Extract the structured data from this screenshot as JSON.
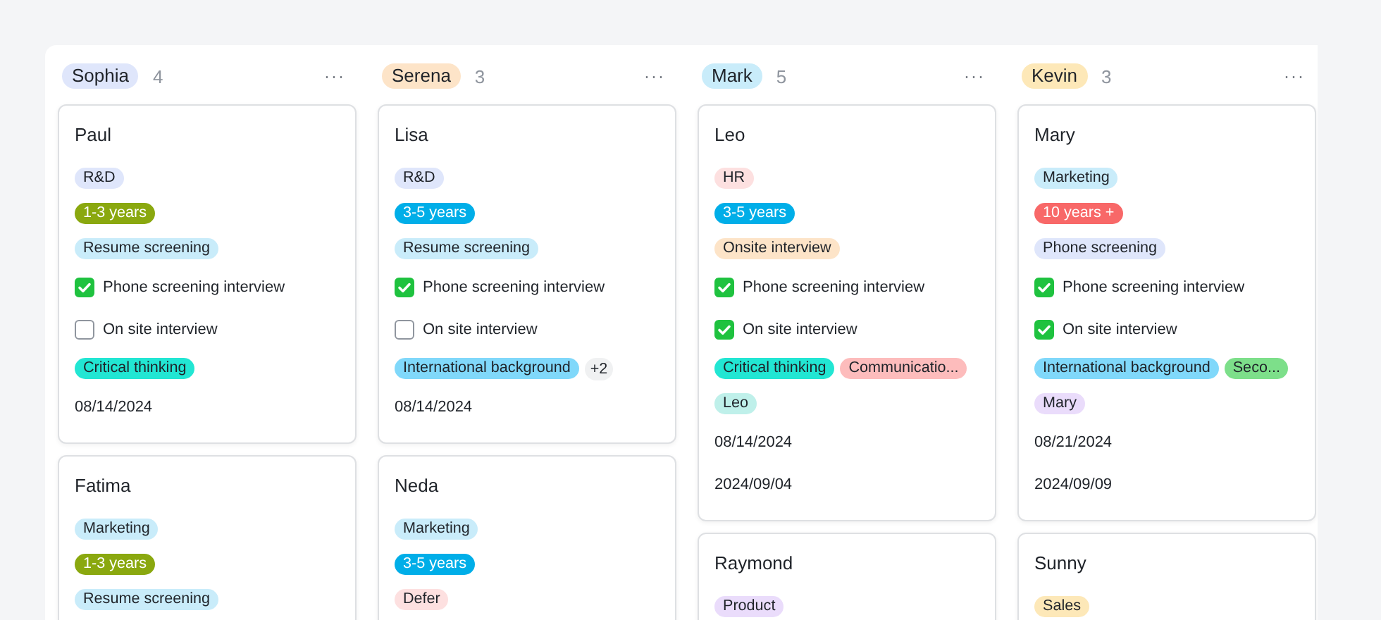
{
  "columns": [
    {
      "owner": {
        "name": "Sophia",
        "color": "#dfe6fb"
      },
      "count": "4",
      "menu": "···",
      "cards": [
        {
          "name": "Paul",
          "rows": [
            {
              "kind": "tag",
              "text": "R&D",
              "color": "#dfe6fb"
            },
            {
              "kind": "tag",
              "text": "1-3 years",
              "color": "#8aa80f"
            },
            {
              "kind": "tag",
              "text": "Resume screening",
              "color": "#c9ecfa"
            },
            {
              "kind": "check",
              "label": "Phone screening interview",
              "checked": true
            },
            {
              "kind": "check",
              "label": "On site interview",
              "checked": false
            },
            {
              "kind": "tags",
              "tags": [
                {
                  "text": "Critical thinking",
                  "color": "#22e6d3"
                }
              ]
            },
            {
              "kind": "date",
              "text": "08/14/2024"
            }
          ]
        },
        {
          "name": "Fatima",
          "rows": [
            {
              "kind": "tag",
              "text": "Marketing",
              "color": "#c9ecfa"
            },
            {
              "kind": "tag",
              "text": "1-3 years",
              "color": "#8aa80f"
            },
            {
              "kind": "tag",
              "text": "Resume screening",
              "color": "#c9ecfa"
            }
          ]
        }
      ]
    },
    {
      "owner": {
        "name": "Serena",
        "color": "#fde4c8"
      },
      "count": "3",
      "menu": "···",
      "cards": [
        {
          "name": "Lisa",
          "rows": [
            {
              "kind": "tag",
              "text": "R&D",
              "color": "#dfe6fb"
            },
            {
              "kind": "tag",
              "text": "3-5 years",
              "color": "#00aee8"
            },
            {
              "kind": "tag",
              "text": "Resume screening",
              "color": "#c9ecfa"
            },
            {
              "kind": "check",
              "label": "Phone screening interview",
              "checked": true
            },
            {
              "kind": "check",
              "label": "On site interview",
              "checked": false
            },
            {
              "kind": "tags",
              "tags": [
                {
                  "text": "International background",
                  "color": "#80d8fa"
                }
              ],
              "more": "+2"
            },
            {
              "kind": "date",
              "text": "08/14/2024"
            }
          ]
        },
        {
          "name": "Neda",
          "rows": [
            {
              "kind": "tag",
              "text": "Marketing",
              "color": "#c9ecfa"
            },
            {
              "kind": "tag",
              "text": "3-5 years",
              "color": "#00aee8"
            },
            {
              "kind": "tag",
              "text": "Defer",
              "color": "#fde0e0"
            }
          ]
        }
      ]
    },
    {
      "owner": {
        "name": "Mark",
        "color": "#c9ecfa"
      },
      "count": "5",
      "menu": "···",
      "cards": [
        {
          "name": "Leo",
          "rows": [
            {
              "kind": "tag",
              "text": "HR",
              "color": "#fde0e0"
            },
            {
              "kind": "tag",
              "text": "3-5 years",
              "color": "#00aee8"
            },
            {
              "kind": "tag",
              "text": "Onsite interview",
              "color": "#fde4c8"
            },
            {
              "kind": "check",
              "label": "Phone screening interview",
              "checked": true
            },
            {
              "kind": "check",
              "label": "On site interview",
              "checked": true
            },
            {
              "kind": "tags",
              "tags": [
                {
                  "text": "Critical thinking",
                  "color": "#22e6d3"
                },
                {
                  "text": "Communicatio...",
                  "color": "#fdbcbc"
                }
              ]
            },
            {
              "kind": "tags",
              "tags": [
                {
                  "text": "Leo",
                  "color": "#bff0ea"
                }
              ]
            },
            {
              "kind": "date",
              "text": "08/14/2024"
            },
            {
              "kind": "date",
              "text": "2024/09/04"
            }
          ]
        },
        {
          "name": "Raymond",
          "rows": [
            {
              "kind": "tag",
              "text": "Product",
              "color": "#eadcfb"
            }
          ]
        }
      ]
    },
    {
      "owner": {
        "name": "Kevin",
        "color": "#fde8b8"
      },
      "count": "3",
      "menu": "···",
      "cards": [
        {
          "name": "Mary",
          "rows": [
            {
              "kind": "tag",
              "text": "Marketing",
              "color": "#c9ecfa"
            },
            {
              "kind": "tag",
              "text": "10 years +",
              "color": "#f86868"
            },
            {
              "kind": "tag",
              "text": "Phone screening",
              "color": "#dfe6fb"
            },
            {
              "kind": "check",
              "label": "Phone screening interview",
              "checked": true
            },
            {
              "kind": "check",
              "label": "On site interview",
              "checked": true
            },
            {
              "kind": "tags",
              "tags": [
                {
                  "text": "International background",
                  "color": "#80d8fa"
                },
                {
                  "text": "Seco...",
                  "color": "#7ddf8a"
                }
              ]
            },
            {
              "kind": "tags",
              "tags": [
                {
                  "text": "Mary",
                  "color": "#eadcfb"
                }
              ]
            },
            {
              "kind": "date",
              "text": "08/21/2024"
            },
            {
              "kind": "date",
              "text": "2024/09/09"
            }
          ]
        },
        {
          "name": "Sunny",
          "rows": [
            {
              "kind": "tag",
              "text": "Sales",
              "color": "#fde8b8"
            }
          ]
        }
      ]
    }
  ]
}
